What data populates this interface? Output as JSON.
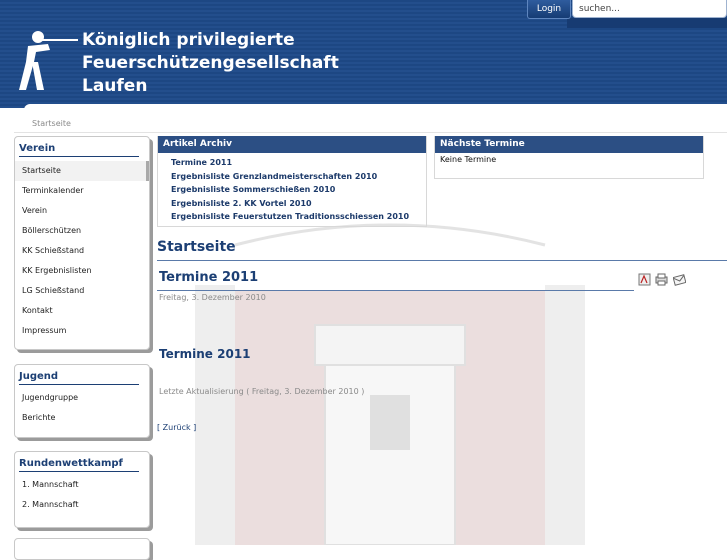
{
  "header": {
    "title_line1": "Königlich privilegierte Feuerschützengesellschaft",
    "title_line2": "Laufen",
    "login_label": "Login",
    "search_placeholder": "suchen..."
  },
  "breadcrumb": "Startseite",
  "sidebar": {
    "verein": {
      "title": "Verein",
      "items": [
        "Startseite",
        "Terminkalender",
        "Verein",
        "Böllerschützen",
        "KK Schießstand",
        "KK Ergebnislisten",
        "LG Schießstand",
        "Kontakt",
        "Impressum"
      ]
    },
    "jugend": {
      "title": "Jugend",
      "items": [
        "Jugendgruppe",
        "Berichte"
      ]
    },
    "rundenwettkampf": {
      "title": "Rundenwettkampf",
      "items": [
        "1. Mannschaft",
        "2. Mannschaft"
      ]
    }
  },
  "archive": {
    "title": "Artikel Archiv",
    "items": [
      "Termine 2011",
      "Ergebnisliste Grenzlandmeisterschaften 2010",
      "Ergebnisliste Sommerschießen 2010",
      "Ergebnisliste 2. KK Vortel 2010",
      "Ergebnisliste Feuerstutzen Traditionsschiessen 2010"
    ]
  },
  "events": {
    "title": "Nächste Termine",
    "empty": "Keine Termine"
  },
  "main": {
    "heading": "Startseite",
    "article_title": "Termine 2011",
    "article_date": "Freitag, 3. Dezember 2010",
    "article_subtitle": "Termine 2011",
    "updated": "Letzte Aktualisierung ( Freitag, 3. Dezember 2010 )",
    "back": "[ Zurück ]"
  },
  "icons": {
    "pdf": "pdf-icon",
    "print": "print-icon",
    "email": "email-icon"
  },
  "colors": {
    "header_blue": "#1d4783",
    "heading_blue": "#1c3f74",
    "panel_head": "#2c4f84"
  }
}
